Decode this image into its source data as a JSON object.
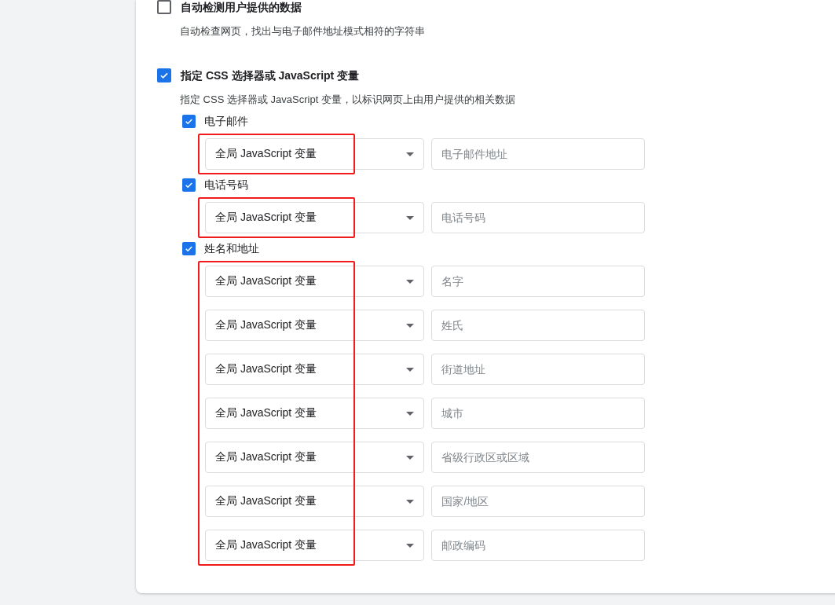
{
  "options": [
    {
      "label": "自动检测用户提供的数据",
      "description": "自动检查网页，找出与电子邮件地址模式相符的字符串",
      "checked": false
    },
    {
      "label": "指定 CSS 选择器或 JavaScript 变量",
      "description": "指定 CSS 选择器或 JavaScript 变量，以标识网页上由用户提供的相关数据",
      "checked": true,
      "groups": [
        {
          "label": "电子邮件",
          "checked": true,
          "annotated": true,
          "fields": [
            {
              "source": "全局 JavaScript 变量",
              "placeholder": "电子邮件地址"
            }
          ]
        },
        {
          "label": "电话号码",
          "checked": true,
          "annotated": true,
          "fields": [
            {
              "source": "全局 JavaScript 变量",
              "placeholder": "电话号码"
            }
          ]
        },
        {
          "label": "姓名和地址",
          "checked": true,
          "annotated": true,
          "fields": [
            {
              "source": "全局 JavaScript 变量",
              "placeholder": "名字"
            },
            {
              "source": "全局 JavaScript 变量",
              "placeholder": "姓氏"
            },
            {
              "source": "全局 JavaScript 变量",
              "placeholder": "街道地址"
            },
            {
              "source": "全局 JavaScript 变量",
              "placeholder": "城市"
            },
            {
              "source": "全局 JavaScript 变量",
              "placeholder": "省级行政区或区域"
            },
            {
              "source": "全局 JavaScript 变量",
              "placeholder": "国家/地区"
            },
            {
              "source": "全局 JavaScript 变量",
              "placeholder": "邮政编码"
            }
          ]
        }
      ]
    }
  ]
}
